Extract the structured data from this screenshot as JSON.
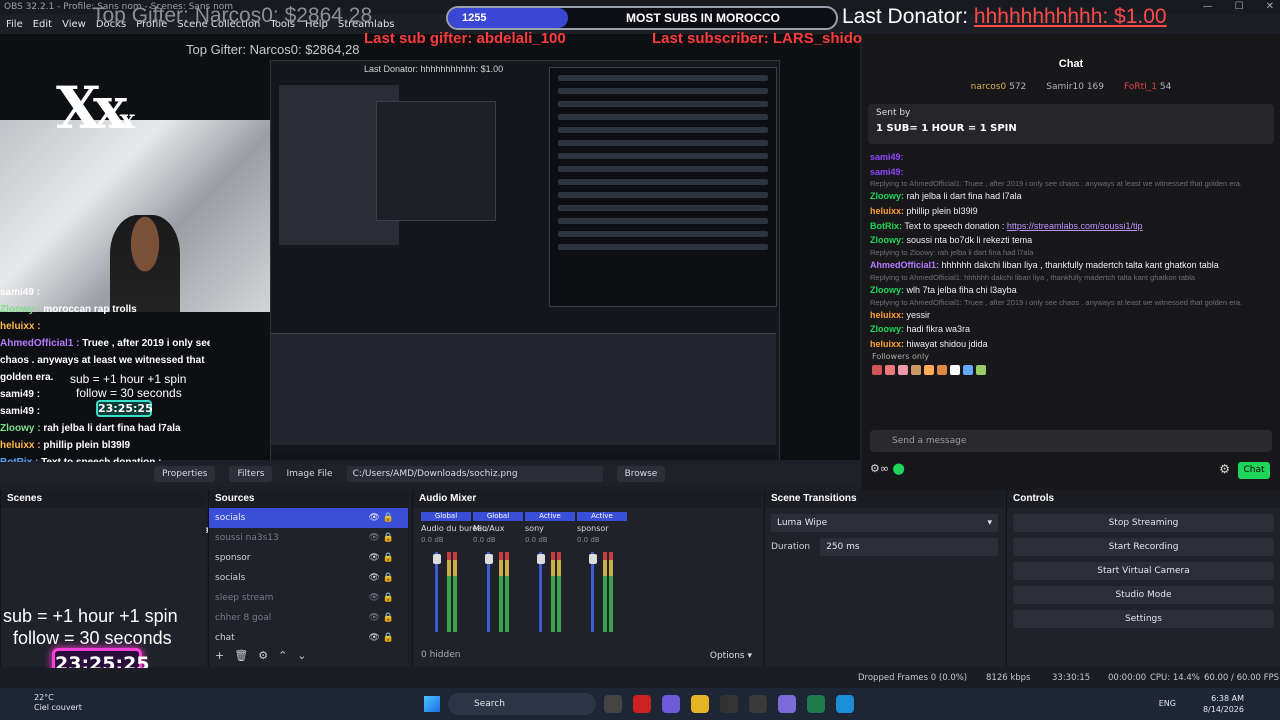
{
  "window": {
    "title": "OBS 32.2.1 - Profile: Sans nom - Scenes: Sans nom",
    "controls": [
      "—",
      "☐",
      "✕"
    ]
  },
  "menu": [
    "File",
    "Edit",
    "View",
    "Docks",
    "Profile",
    "Scene Collection",
    "Tools",
    "Help",
    "Streamlabs"
  ],
  "overlay": {
    "top_gifter": "Top Gifter: Narcos0: $2864,28",
    "subs_count": "1255",
    "subs_goal": "MOST SUBS IN MOROCCO",
    "last_donator_label": "Last Donator:",
    "last_donator_value": "hhhhhhhhhhh: $1.00",
    "last_sub_gifter": "Last sub gifter: abdelali_100",
    "last_subscriber": "Last subscriber: LARS_shidou_y",
    "nested_top_gifter": "Top Gifter: Narcos0: $2864,28",
    "nested_last_donator": "Last Donator: hhhhhhhhhhh: $1.00",
    "sub_rule_small": "sub  = +1 hour +1 spin",
    "follow_rule_small": "follow = 30 seconds",
    "timer_small": "23:25:25",
    "sub_rule_big": "sub  = +1 hour +1 spin",
    "follow_rule_big": "follow = 30 seconds",
    "timer_big": "23:25:25"
  },
  "overlay_chat": [
    {
      "user": "sami49 :",
      "cls": "u-s",
      "text": ""
    },
    {
      "user": "Zloowy :",
      "cls": "u-z",
      "text": "moroccan rap trolls"
    },
    {
      "user": "heluixx :",
      "cls": "u-h",
      "text": ""
    },
    {
      "user": "AhmedOfficial1 :",
      "cls": "u-a",
      "text": "Truee , after 2019 i only see"
    },
    {
      "user": "",
      "cls": "u-s",
      "text": "chaos . anyways at least we witnessed that"
    },
    {
      "user": "",
      "cls": "u-s",
      "text": "golden era."
    },
    {
      "user": "sami49 :",
      "cls": "u-s",
      "text": ""
    },
    {
      "user": "sami49 :",
      "cls": "u-s",
      "text": ""
    },
    {
      "user": "Zloowy :",
      "cls": "u-z",
      "text": "rah jelba li dart fina had l7ala"
    },
    {
      "user": "heluixx :",
      "cls": "u-h",
      "text": "phillip plein bl39l9"
    },
    {
      "user": "BotRix :",
      "cls": "u-b",
      "text": "Text to speech donation :"
    },
    {
      "user": "",
      "cls": "u-s",
      "text": "https://streamlabs.com/soussi1/tip"
    },
    {
      "user": "Zloowy :",
      "cls": "u-z",
      "text": "soussi nta bo7dk li rekezti tema"
    },
    {
      "user": "AhmedOfficial1 :",
      "cls": "u-a",
      "text": "hhhhhh dakchi liban liya ,"
    },
    {
      "user": "",
      "cls": "u-s",
      "text": "thankfully madertch talta kant ghatkon tabla"
    },
    {
      "user": "Zloowy :",
      "cls": "u-z",
      "text": "wlh 7ta jelba fiha chi l3ayba"
    },
    {
      "user": "heluixx :",
      "cls": "u-h",
      "text": "yessir"
    },
    {
      "user": "Zloowy :",
      "cls": "u-z",
      "text": "hadi fikra wa3ra"
    },
    {
      "user": "heluixx :",
      "cls": "u-h",
      "text": "hiwayat shidou jdida"
    }
  ],
  "chat": {
    "title": "Chat",
    "top": [
      {
        "name": "narcos0",
        "count": "572"
      },
      {
        "name": "Samir10",
        "count": "169"
      },
      {
        "name": "FoRtI_1",
        "count": "54"
      }
    ],
    "pinned_by": "Sent by",
    "pinned_text": "1 SUB= 1 HOUR = 1 SPIN",
    "messages": [
      {
        "type": "msg",
        "user": "sami49:",
        "color": "#9147ff",
        "text": ""
      },
      {
        "type": "msg",
        "user": "sami49:",
        "color": "#9147ff",
        "text": ""
      },
      {
        "type": "reply",
        "text": "Replying to AhmedOfficial1: Truee , after 2019 i only see chaos . anyways at least we witnessed that golden era."
      },
      {
        "type": "msg",
        "user": "Zloowy:",
        "color": "#1fd65a",
        "text": "rah jelba li dart fina had l7ala"
      },
      {
        "type": "msg",
        "user": "heluixx:",
        "color": "#ff9f2e",
        "text": "phillip plein bl39l9"
      },
      {
        "type": "link",
        "user": "BotRix:",
        "color": "#1fd65a",
        "text": "Text to speech donation : ",
        "link": "https://streamlabs.com/soussi1/tip"
      },
      {
        "type": "msg",
        "user": "Zloowy:",
        "color": "#1fd65a",
        "text": "soussi nta bo7dk li rekezti tema"
      },
      {
        "type": "reply",
        "text": "Replying to Zloowy: rah jelba li dart fina had l7ala"
      },
      {
        "type": "msg",
        "user": "AhmedOfficial1:",
        "color": "#b57bff",
        "text": "hhhhhh dakchi liban liya , thankfully madertch talta kant ghatkon tabla"
      },
      {
        "type": "reply",
        "text": "Replying to AhmedOfficial1: hhhhhh dakchi liban liya , thankfully madertch talta kant ghatkon tabla"
      },
      {
        "type": "msg",
        "user": "Zloowy:",
        "color": "#1fd65a",
        "text": "wlh 7ta jelba fiha chi l3ayba"
      },
      {
        "type": "reply",
        "text": "Replying to AhmedOfficial1: Truee , after 2019 i only see chaos . anyways at least we witnessed that golden era."
      },
      {
        "type": "msg",
        "user": "heluixx:",
        "color": "#ff9f2e",
        "text": "yessir"
      },
      {
        "type": "msg",
        "user": "Zloowy:",
        "color": "#1fd65a",
        "text": "hadi fikra wa3ra"
      },
      {
        "type": "msg",
        "user": "heluixx:",
        "color": "#ff9f2e",
        "text": "hiwayat shidou jdida"
      }
    ],
    "followers_only": "Followers only",
    "send_placeholder": "Send a message",
    "chat_button": "Chat"
  },
  "properties_bar": {
    "properties": "Properties",
    "filters": "Filters",
    "type": "Image File",
    "path": "C:/Users/AMD/Downloads/sochiz.png",
    "browse": "Browse"
  },
  "scenes": {
    "title": "Scenes"
  },
  "sources": {
    "title": "Sources",
    "items": [
      {
        "name": "socials",
        "state": "sel"
      },
      {
        "name": "soussi na3s13",
        "state": "dim"
      },
      {
        "name": "sponsor",
        "state": ""
      },
      {
        "name": "socials",
        "state": ""
      },
      {
        "name": "sleep stream",
        "state": "dim"
      },
      {
        "name": "chher 8 goal",
        "state": "dim"
      },
      {
        "name": "chat",
        "state": ""
      }
    ]
  },
  "mixer": {
    "title": "Audio Mixer",
    "channels": [
      {
        "tag": "Global",
        "name": "Audio du bureau",
        "db": "0.0 dB"
      },
      {
        "tag": "Global",
        "name": "Mic/Aux",
        "db": "0.0 dB"
      },
      {
        "tag": "Active",
        "name": "sony",
        "db": "0.0 dB"
      },
      {
        "tag": "Active",
        "name": "sponsor",
        "db": "0.0 dB"
      }
    ],
    "hidden": "0 hidden",
    "options": "Options"
  },
  "transitions": {
    "title": "Scene Transitions",
    "type": "Luma Wipe",
    "duration_label": "Duration",
    "duration": "250 ms"
  },
  "controls": {
    "title": "Controls",
    "buttons": [
      "Stop Streaming",
      "Start Recording",
      "Start Virtual Camera",
      "Studio Mode",
      "Settings"
    ]
  },
  "status": {
    "dropped": "Dropped Frames 0 (0.0%)",
    "bitrate": "8126 kbps",
    "live": "33:30:15",
    "rec": "00:00:00",
    "cpu": "CPU: 14.4%",
    "fps": "60.00 / 60.00 FPS"
  },
  "taskbar": {
    "temp": "22°C",
    "weather": "Ciel couvert",
    "search": "Search",
    "lang": "ENG",
    "time": "6:38 AM",
    "date": "8/14/2026"
  }
}
